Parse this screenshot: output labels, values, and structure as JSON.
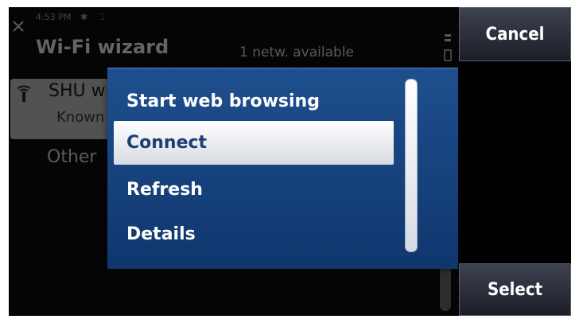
{
  "status_bar": {
    "time": "4:53 PM",
    "icons": "✱ ⌶"
  },
  "app": {
    "title": "Wi-Fi wizard",
    "network_count": "1 netw. available",
    "network": {
      "name": "SHU w",
      "status": "Known"
    },
    "other_label": "Other"
  },
  "menu": {
    "items": [
      {
        "label": "Start web browsing"
      },
      {
        "label": "Connect"
      },
      {
        "label": "Refresh"
      },
      {
        "label": "Details"
      }
    ],
    "selected_index": 1
  },
  "softkeys": {
    "top": "Cancel",
    "bottom": "Select"
  },
  "colors": {
    "menu_bg": "#1b4a87",
    "highlight": "#f2f3f6",
    "softkey": "#2c2f3a"
  }
}
